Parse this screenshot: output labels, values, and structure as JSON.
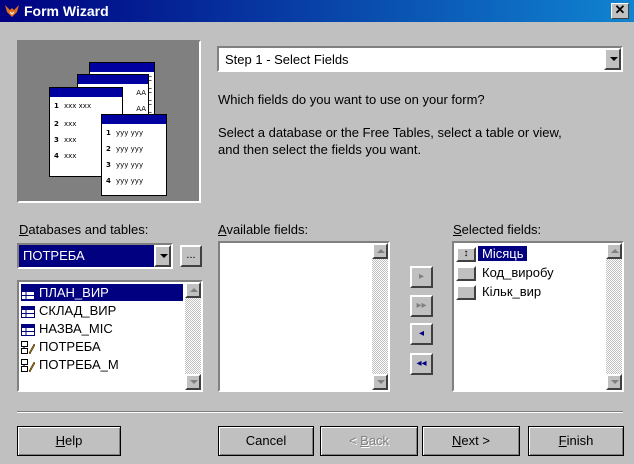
{
  "window": {
    "title": "Form Wizard",
    "close_glyph": "✕"
  },
  "step_select": {
    "value": "Step 1 - Select Fields"
  },
  "instructions": {
    "question": "Which fields do you want to use on your form?",
    "line1": "Select a database or the Free Tables, select a table or view,",
    "line2": "and then select the fields you want."
  },
  "preview": {
    "back_rows": [
      "C",
      "C",
      "C",
      "C"
    ],
    "front_left": [
      {
        "n": "1",
        "v": "xxx xxx"
      },
      {
        "n": "2",
        "v": "xxx"
      },
      {
        "n": "3",
        "v": "xxx"
      },
      {
        "n": "4",
        "v": "xxx"
      }
    ],
    "front_right": [
      {
        "n": "1",
        "v": "yyy yyy"
      },
      {
        "n": "2",
        "v": "yyy yyy"
      },
      {
        "n": "3",
        "v": "yyy yyy"
      },
      {
        "n": "4",
        "v": "yyy yyy"
      }
    ],
    "mid_labels": [
      "AA",
      "AA"
    ]
  },
  "databases": {
    "label_prefix": "D",
    "label_rest": "atabases and tables:",
    "selected_db": "ПОТРЕБА",
    "browse_label": "...",
    "items": [
      {
        "label": "ПЛАН_ВИР",
        "icon": "table-icon",
        "selected": true
      },
      {
        "label": "СКЛАД_ВИР",
        "icon": "table-icon",
        "selected": false
      },
      {
        "label": "НАЗВА_МІС",
        "icon": "table-icon",
        "selected": false
      },
      {
        "label": "ПОТРЕБА",
        "icon": "view-icon",
        "selected": false
      },
      {
        "label": "ПОТРЕБА_М",
        "icon": "view-icon",
        "selected": false
      }
    ]
  },
  "available": {
    "label_prefix": "A",
    "label_rest": "vailable fields:"
  },
  "selected": {
    "label_prefix": "S",
    "label_rest": "elected fields:",
    "items": [
      {
        "label": "Місяць",
        "selected": true
      },
      {
        "label": "Код_виробу",
        "selected": false
      },
      {
        "label": "Кільк_вир",
        "selected": false
      }
    ]
  },
  "movers": {
    "add": "▸",
    "add_all": "▸▸",
    "remove": "◂",
    "remove_all": "◂◂"
  },
  "buttons": {
    "help_prefix": "H",
    "help_rest": "elp",
    "cancel": "Cancel",
    "back_pre": "< ",
    "back_u": "B",
    "back_rest": "ack",
    "next_u": "N",
    "next_rest": "ext >",
    "finish_u": "F",
    "finish_rest": "inish"
  }
}
